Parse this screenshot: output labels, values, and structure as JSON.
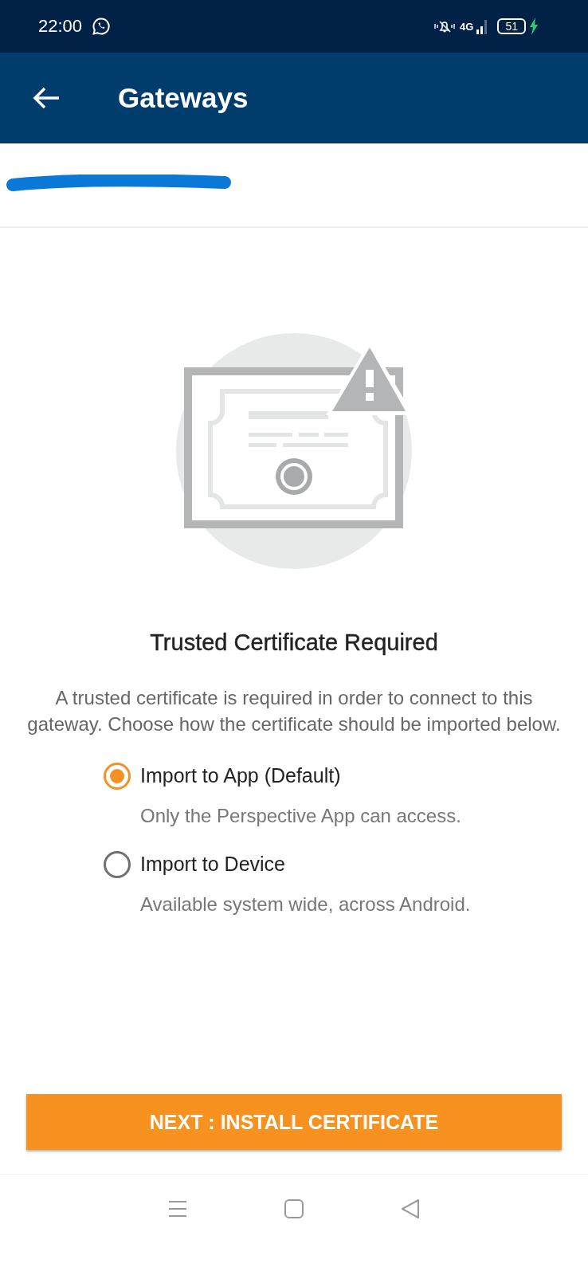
{
  "status_bar": {
    "time": "22:00",
    "network": "4G",
    "battery": "51"
  },
  "app_bar": {
    "title": "Gateways"
  },
  "content": {
    "heading": "Trusted Certificate Required",
    "description": "A trusted certificate is required in order to connect to this gateway. Choose how the certificate should be imported below.",
    "options": [
      {
        "label": "Import to App (Default)",
        "hint": "Only the Perspective App can access.",
        "selected": true
      },
      {
        "label": "Import to Device",
        "hint": "Available system wide, across Android.",
        "selected": false
      }
    ]
  },
  "button": {
    "label": "NEXT : INSTALL CERTIFICATE"
  }
}
